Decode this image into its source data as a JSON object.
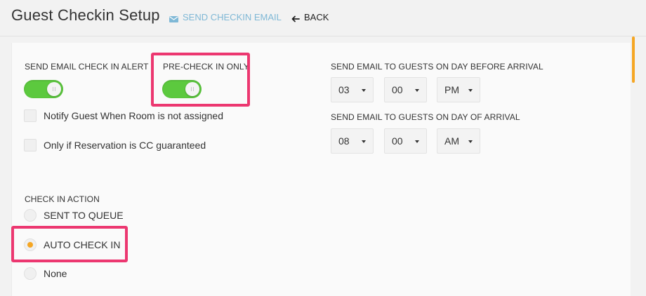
{
  "header": {
    "title": "Guest Checkin Setup",
    "send_email_label": "SEND CHECKIN EMAIL",
    "back_label": "BACK"
  },
  "alerts": {
    "send_email_alert_label": "SEND EMAIL CHECK IN ALERT",
    "send_email_alert_on": true,
    "precheck_label": "PRE-CHECK IN ONLY",
    "precheck_on": true,
    "notify_unassigned_label": "Notify Guest When Room is not assigned",
    "notify_unassigned_checked": false,
    "cc_guaranteed_label": "Only if Reservation is CC guaranteed",
    "cc_guaranteed_checked": false
  },
  "schedule": {
    "before_arrival_label": "SEND EMAIL TO GUESTS ON DAY BEFORE ARRIVAL",
    "before_hour": "03",
    "before_minute": "00",
    "before_ampm": "PM",
    "day_of_label": "SEND EMAIL TO GUESTS ON DAY OF ARRIVAL",
    "dayof_hour": "08",
    "dayof_minute": "00",
    "dayof_ampm": "AM"
  },
  "check_in_action": {
    "label": "CHECK IN ACTION",
    "options": [
      {
        "label": "SENT TO QUEUE",
        "selected": false
      },
      {
        "label": "AUTO CHECK IN",
        "selected": true
      },
      {
        "label": "None",
        "selected": false
      }
    ]
  },
  "colors": {
    "toggle_on": "#5cc93e",
    "highlight": "#ec3770",
    "accent": "#f5a623",
    "link": "#7fb8d6"
  },
  "icons": {
    "send_email": "envelope-icon",
    "back": "arrow-left-icon"
  }
}
